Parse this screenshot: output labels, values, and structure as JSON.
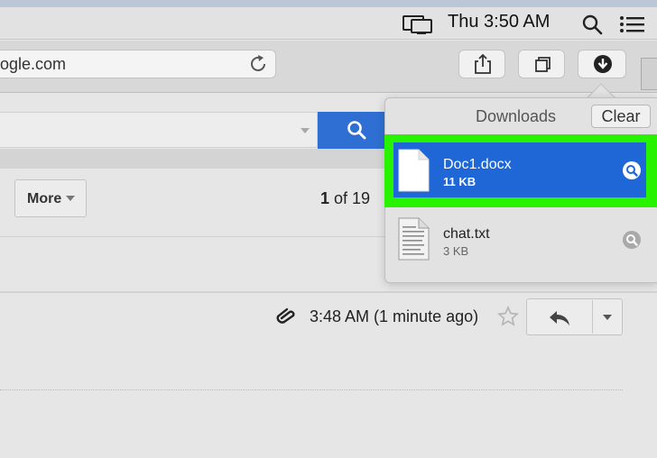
{
  "menubar": {
    "clock": "Thu 3:50 AM",
    "icons": [
      "display-icon",
      "search-icon",
      "list-icon"
    ]
  },
  "browser": {
    "url": "ogle.com",
    "buttons": [
      "share-icon",
      "tabs-icon",
      "download-icon"
    ]
  },
  "mail": {
    "more_label": "More",
    "pager_current": "1",
    "pager_rest": " of 19",
    "message_time": "3:48 AM (1 minute ago)"
  },
  "downloads": {
    "title": "Downloads",
    "clear_label": "Clear",
    "items": [
      {
        "name": "Doc1.docx",
        "size": "11 KB",
        "selected": true
      },
      {
        "name": "chat.txt",
        "size": "3 KB",
        "selected": false
      }
    ]
  },
  "colors": {
    "selection_blue": "#1f67d6",
    "highlight_green": "#27f200",
    "search_blue": "#2f6fd3"
  }
}
